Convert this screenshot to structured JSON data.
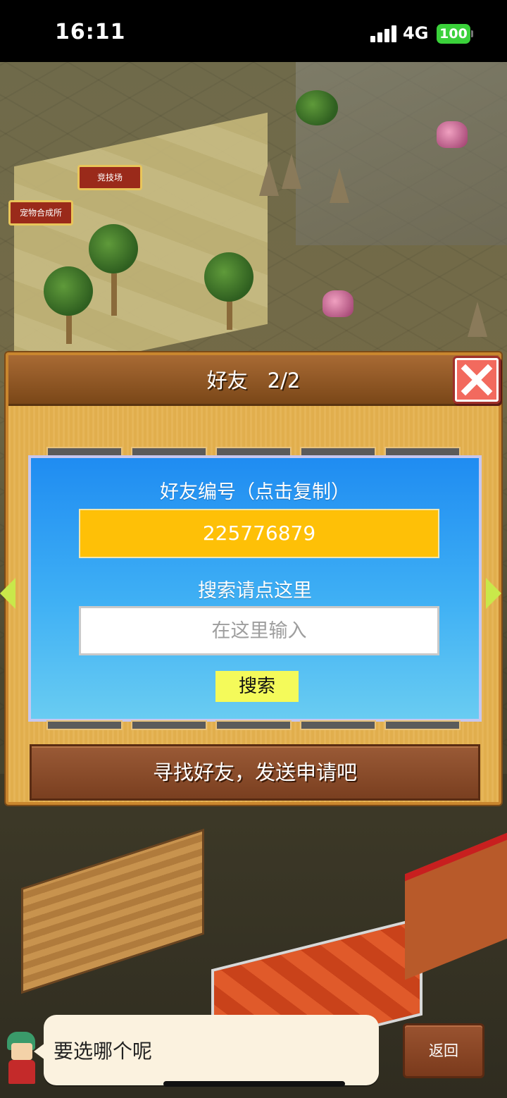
{
  "status_bar": {
    "time": "16:11",
    "network": "4G",
    "battery": "100",
    "battery_color": "#3ad13a"
  },
  "map": {
    "labels": {
      "arena": "竞技场",
      "pet_fusion": "宠物合成所"
    }
  },
  "dialog": {
    "title": "好友",
    "page": "2/2",
    "close_icon": "close-x-icon",
    "friend_id_caption": "好友编号（点击复制）",
    "friend_id": "225776879",
    "search_caption": "搜索请点这里",
    "search_placeholder": "在这里输入",
    "search_button": "搜索",
    "request_hint": "寻找好友，发送申请吧",
    "colors": {
      "id_field": "#fec007",
      "search_button": "#f4fa5a",
      "close_button": "#f26a5e"
    }
  },
  "bottom": {
    "speech": "要选哪个呢",
    "back_button": "返回"
  }
}
